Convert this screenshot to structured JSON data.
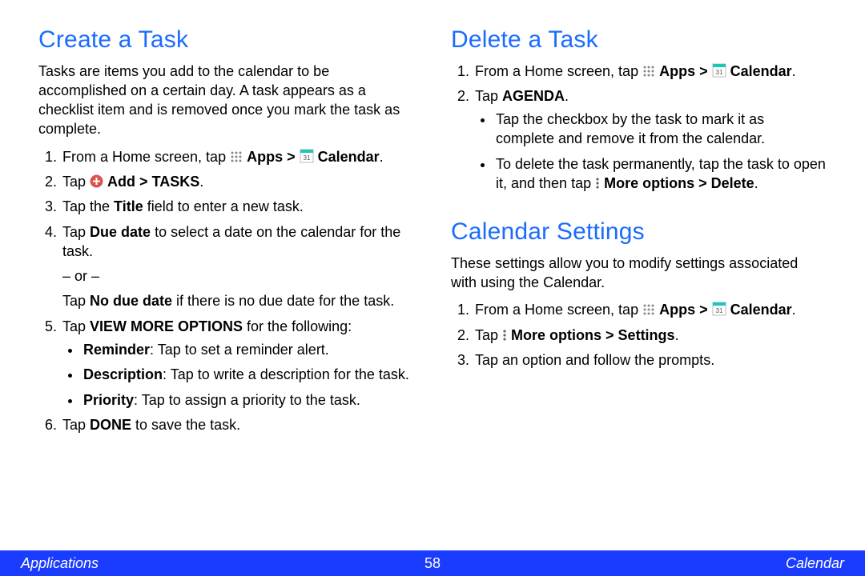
{
  "left": {
    "heading": "Create a Task",
    "intro": "Tasks are items you add to the calendar to be accomplished on a certain day. A task appears as a checklist item and is removed once you mark the task as complete.",
    "step1_pre": "From a Home screen, tap ",
    "apps_label": "Apps",
    "gt": " > ",
    "calendar_label": "Calendar",
    "period": ".",
    "step2_pre": "Tap ",
    "step2_add": "Add >",
    "step2_tasks": " TASKS",
    "step3_pre": "Tap the ",
    "step3_title": "Title",
    "step3_post": " field to enter a new task.",
    "step4_pre": "Tap ",
    "step4_due": "Due date",
    "step4_post": " to select a date on the calendar for the task.",
    "or": "– or –",
    "step4b_pre": "Tap ",
    "step4b_ndd": "No due date",
    "step4b_post": " if there is no due date for the task.",
    "step5_pre": "Tap ",
    "step5_vmo": "VIEW MORE OPTIONS",
    "step5_post": " for the following:",
    "b1_t": "Reminder",
    "b1_p": ": Tap to set a reminder alert.",
    "b2_t": "Description",
    "b2_p": ": Tap to write a description for the task.",
    "b3_t": "Priority",
    "b3_p": ": Tap to assign a priority to the task.",
    "step6_pre": "Tap ",
    "step6_done": "DONE",
    "step6_post": " to save the task."
  },
  "right": {
    "heading1": "Delete a Task",
    "d_step1_pre": "From a Home screen, tap ",
    "d_step2_pre": "Tap ",
    "d_step2_ag": "AGENDA",
    "d_b1": "Tap the checkbox by the task to mark it as complete and remove it from the calendar.",
    "d_b2_pre": "To delete the task permanently, tap the task to open it, and then tap ",
    "d_b2_more": "More options > Delete",
    "heading2": "Calendar Settings",
    "cs_intro": "These settings allow you to modify settings associated with using the Calendar.",
    "cs_step2_pre": "Tap ",
    "cs_step2_more": "More options > Settings",
    "cs_step3": "Tap an option and follow the prompts."
  },
  "footer": {
    "left": "Applications",
    "center": "58",
    "right": "Calendar"
  },
  "icons": {
    "apps": "apps-grid-icon",
    "calendar": "calendar-31-icon",
    "add": "add-circle-icon",
    "more": "more-options-icon"
  }
}
